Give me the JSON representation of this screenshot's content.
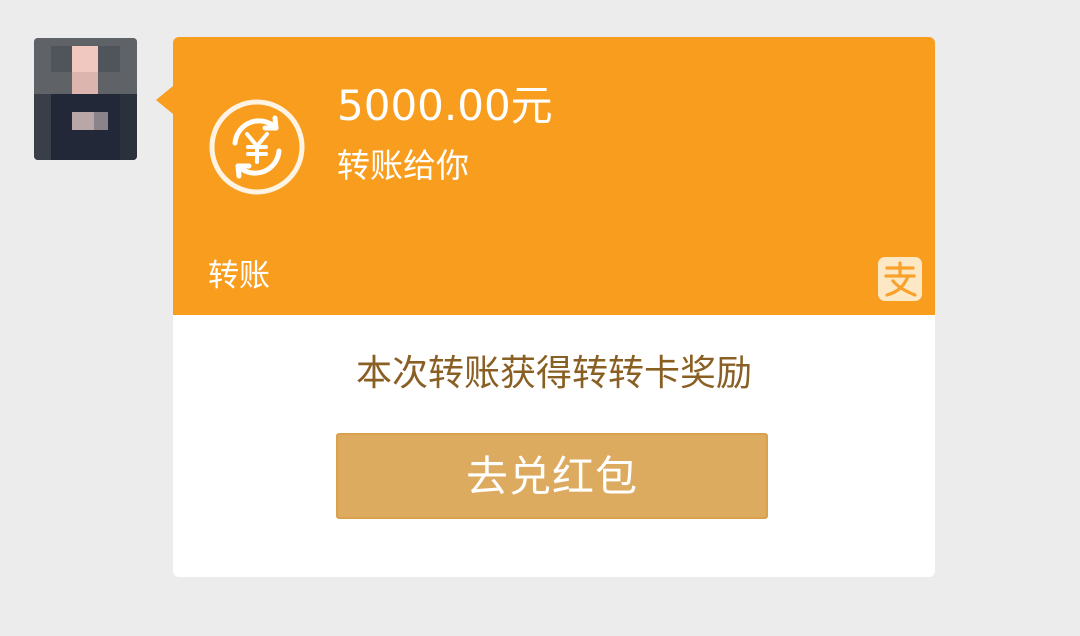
{
  "chat": {
    "sender_avatar": {
      "icon": "avatar-icon",
      "colors": [
        "#5f6267",
        "#2e3342",
        "#212737",
        "#f0c8c0",
        "#d9b2ae",
        "#b9a7a8"
      ]
    },
    "transfer_card": {
      "amount": "5000.00元",
      "description": "转账给你",
      "type_label": "转账",
      "icons": {
        "transfer": "transfer-yuan-icon",
        "alipay": "alipay-logo-icon"
      },
      "colors": {
        "card_orange": "#f99d1e",
        "reward_text": "#8a5f24",
        "button_fill": "#ddab5f"
      },
      "reward_text": "本次转账获得转转卡奖励",
      "redeem_button_label": "去兑红包"
    }
  }
}
